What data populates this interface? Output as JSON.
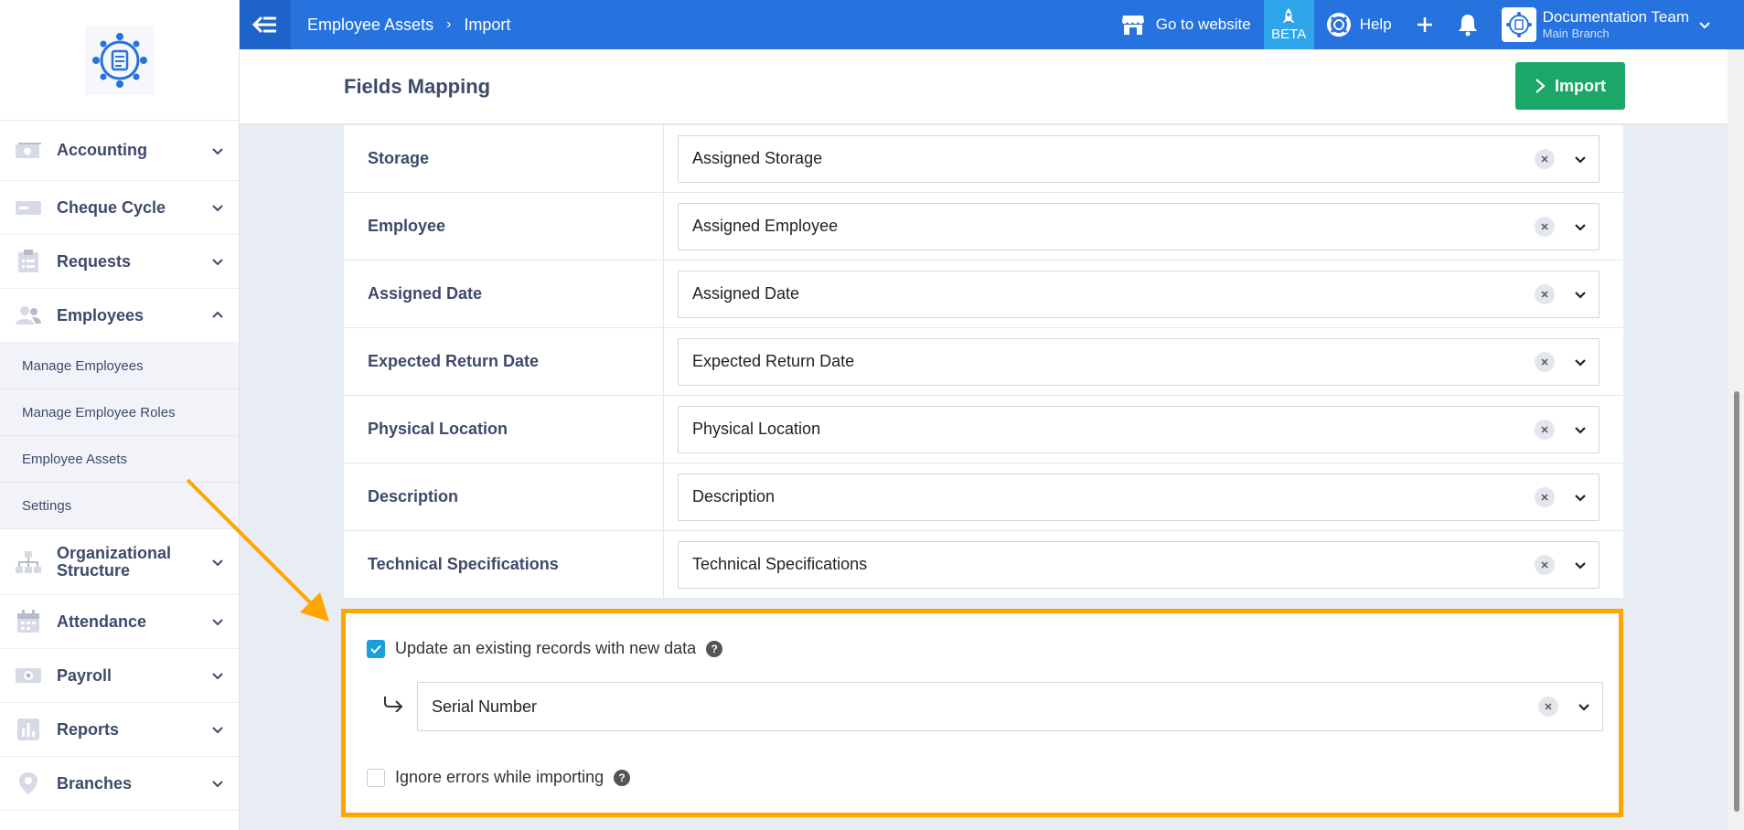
{
  "topbar": {
    "breadcrumb": [
      "Employee Assets",
      "Import"
    ],
    "goto_website": "Go to website",
    "beta": "BETA",
    "help": "Help",
    "account_name": "Documentation Team",
    "account_branch": "Main Branch"
  },
  "sidebar": {
    "items": [
      {
        "label": "Accounting",
        "icon": "money-icon"
      },
      {
        "label": "Cheque Cycle",
        "icon": "cheque-icon"
      },
      {
        "label": "Requests",
        "icon": "clipboard-icon"
      },
      {
        "label": "Employees",
        "icon": "users-icon"
      },
      {
        "label": "Organizational Structure",
        "icon": "org-chart-icon"
      },
      {
        "label": "Attendance",
        "icon": "calendar-icon"
      },
      {
        "label": "Payroll",
        "icon": "payroll-icon"
      },
      {
        "label": "Reports",
        "icon": "chart-icon"
      },
      {
        "label": "Branches",
        "icon": "location-icon"
      }
    ],
    "employees_sub": [
      "Manage Employees",
      "Manage Employee Roles",
      "Employee Assets",
      "Settings"
    ]
  },
  "header": {
    "title": "Fields Mapping",
    "import_label": "Import"
  },
  "mapping": [
    {
      "field": "Storage",
      "value": "Assigned Storage"
    },
    {
      "field": "Employee",
      "value": "Assigned Employee"
    },
    {
      "field": "Assigned Date",
      "value": "Assigned Date"
    },
    {
      "field": "Expected Return Date",
      "value": "Expected Return Date"
    },
    {
      "field": "Physical Location",
      "value": "Physical Location"
    },
    {
      "field": "Description",
      "value": "Description"
    },
    {
      "field": "Technical Specifications",
      "value": "Technical Specifications"
    }
  ],
  "options": {
    "update_label": "Update an existing records with new data",
    "update_checked": true,
    "match_field": "Serial Number",
    "ignore_label": "Ignore errors while importing",
    "ignore_checked": false
  },
  "colors": {
    "primary": "#2672de",
    "import_button": "#1aa768",
    "highlight": "#ffa500",
    "checkbox": "#1a9fdd"
  }
}
